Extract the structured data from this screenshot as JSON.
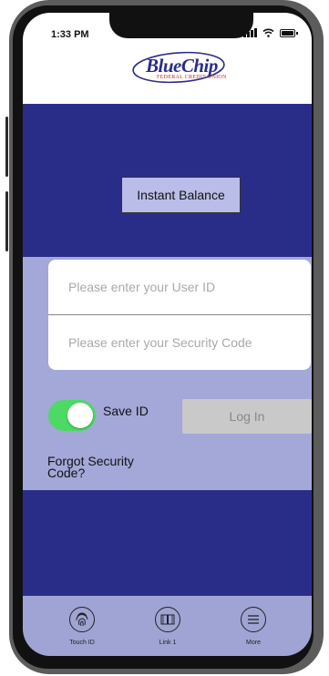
{
  "status_bar": {
    "time": "1:33 PM"
  },
  "logo": {
    "name": "BlueChip",
    "tagline": "FEDERAL CREDIT UNION"
  },
  "instant_balance": {
    "label": "Instant Balance"
  },
  "login_form": {
    "user_id_placeholder": "Please enter your User ID",
    "security_code_placeholder": "Please enter your Security Code",
    "save_id_label": "Save ID",
    "save_id_on": true,
    "login_label": "Log In",
    "forgot_label": "Forgot Security Code?"
  },
  "tabbar": {
    "items": [
      {
        "label": "Touch ID",
        "icon": "fingerprint-icon"
      },
      {
        "label": "Link 1",
        "icon": "book-icon"
      },
      {
        "label": "More",
        "icon": "menu-icon"
      }
    ]
  },
  "colors": {
    "dark_blue": "#2a2d88",
    "light_blue": "#a3a8d8",
    "toggle_green": "#4cd964",
    "logo_red": "#c0282d"
  }
}
